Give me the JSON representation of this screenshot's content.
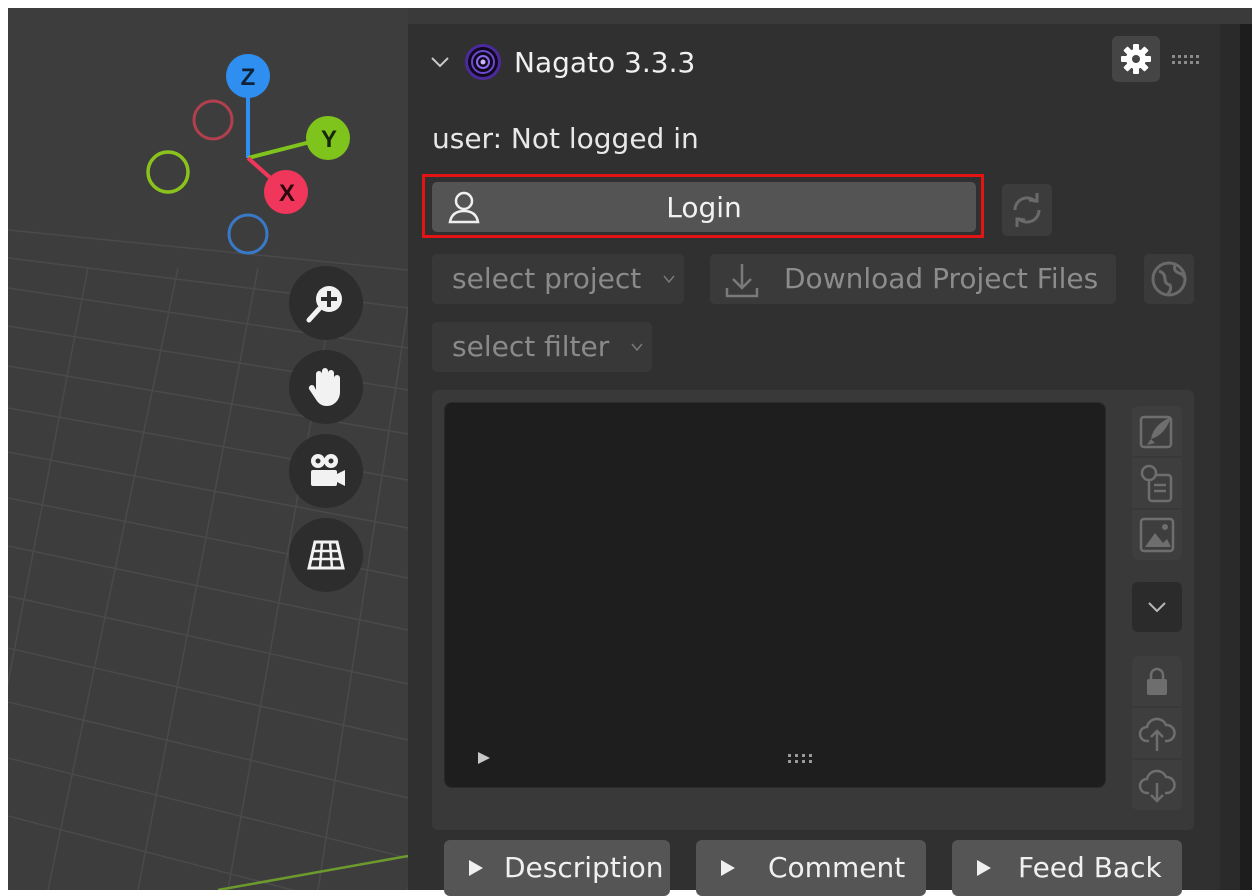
{
  "gizmo": {
    "z_label": "Z",
    "y_label": "Y",
    "x_label": "X"
  },
  "panel": {
    "title": "Nagato 3.3.3",
    "user_status": "user: Not logged in",
    "login_label": "Login",
    "select_project": "select project",
    "download_label": "Download Project Files",
    "select_filter": "select filter",
    "buttons": {
      "description": "Description",
      "comment": "Comment",
      "feedback": "Feed Back"
    }
  },
  "colors": {
    "axis_x": "#f0375b",
    "axis_y": "#7fc31d",
    "axis_z": "#2f8ff0",
    "highlight": "#e41414"
  },
  "icons": [
    "chevron-down-icon",
    "nagato-logo-icon",
    "gear-icon",
    "drag-handle-icon",
    "user-icon",
    "refresh-icon",
    "download-icon",
    "globe-icon",
    "zoom-icon",
    "hand-icon",
    "camera-icon",
    "grid-icon",
    "rocket-icon",
    "clipboard-icon",
    "image-icon",
    "expand-icon",
    "lock-icon",
    "cloud-upload-icon",
    "cloud-download-icon",
    "play-icon"
  ]
}
